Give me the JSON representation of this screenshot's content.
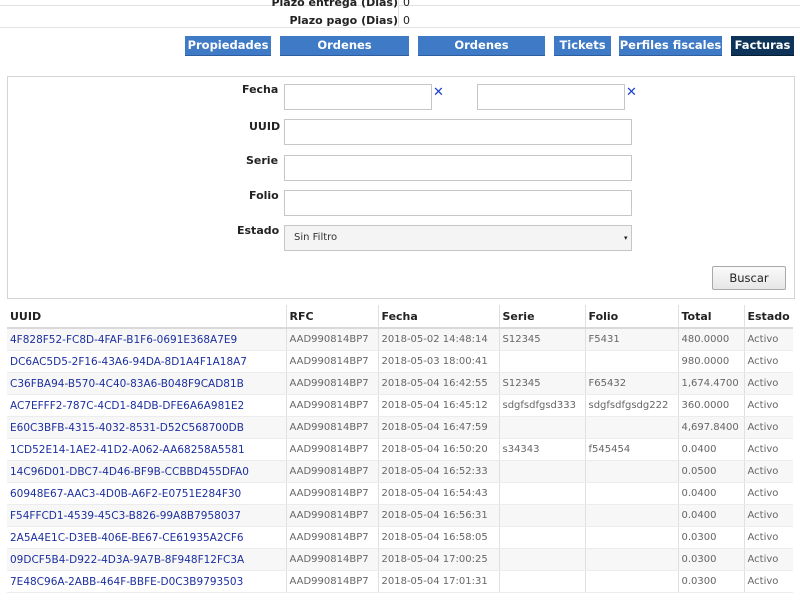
{
  "info": {
    "rows": [
      {
        "label": "Plazo entrega (Dias)",
        "value": "0"
      },
      {
        "label": "Plazo pago (Dias)",
        "value": "0"
      }
    ]
  },
  "tabs": [
    {
      "label": "Propiedades"
    },
    {
      "label": "Ordenes Pendientes"
    },
    {
      "label": "Ordenes Finalizadas"
    },
    {
      "label": "Tickets"
    },
    {
      "label": "Perfiles fiscales"
    },
    {
      "label": "Facturas",
      "active": true
    }
  ],
  "filters": {
    "fecha_label": "Fecha",
    "fecha_from": "",
    "fecha_to": "",
    "clear_glyph": "✕",
    "uuid_label": "UUID",
    "uuid_value": "",
    "serie_label": "Serie",
    "serie_value": "",
    "folio_label": "Folio",
    "folio_value": "",
    "estado_label": "Estado",
    "estado_selected": "Sin Filtro",
    "search_label": "Buscar"
  },
  "table": {
    "headers": [
      "UUID",
      "RFC",
      "Fecha",
      "Serie",
      "Folio",
      "Total",
      "Estado"
    ],
    "rows": [
      [
        "4F828F52-FC8D-4FAF-B1F6-0691E368A7E9",
        "AAD990814BP7",
        "2018-05-02 14:48:14",
        "S12345",
        "F5431",
        "480.0000",
        "Activo"
      ],
      [
        "DC6AC5D5-2F16-43A6-94DA-8D1A4F1A18A7",
        "AAD990814BP7",
        "2018-05-03 18:00:41",
        "",
        "",
        "980.0000",
        "Activo"
      ],
      [
        "C36FBA94-B570-4C40-83A6-B048F9CAD81B",
        "AAD990814BP7",
        "2018-05-04 16:42:55",
        "S12345",
        "F65432",
        "1,674.4700",
        "Activo"
      ],
      [
        "AC7EFFF2-787C-4CD1-84DB-DFE6A6A981E2",
        "AAD990814BP7",
        "2018-05-04 16:45:12",
        "sdgfsdfgsd333",
        "sdgfsdfgsdg222",
        "360.0000",
        "Activo"
      ],
      [
        "E60C3BFB-4315-4032-8531-D52C568700DB",
        "AAD990814BP7",
        "2018-05-04 16:47:59",
        "",
        "",
        "4,697.8400",
        "Activo"
      ],
      [
        "1CD52E14-1AE2-41D2-A062-AA68258A5581",
        "AAD990814BP7",
        "2018-05-04 16:50:20",
        "s34343",
        "f545454",
        "0.0400",
        "Activo"
      ],
      [
        "14C96D01-DBC7-4D46-BF9B-CCBBD455DFA0",
        "AAD990814BP7",
        "2018-05-04 16:52:33",
        "",
        "",
        "0.0500",
        "Activo"
      ],
      [
        "60948E67-AAC3-4D0B-A6F2-E0751E284F30",
        "AAD990814BP7",
        "2018-05-04 16:54:43",
        "",
        "",
        "0.0400",
        "Activo"
      ],
      [
        "F54FFCD1-4539-45C3-B826-99A8B7958037",
        "AAD990814BP7",
        "2018-05-04 16:56:31",
        "",
        "",
        "0.0400",
        "Activo"
      ],
      [
        "2A5A4E1C-D3EB-406E-BE67-CE61935A2CF6",
        "AAD990814BP7",
        "2018-05-04 16:58:05",
        "",
        "",
        "0.0300",
        "Activo"
      ],
      [
        "09DCF5B4-D922-4D3A-9A7B-8F948F12FC3A",
        "AAD990814BP7",
        "2018-05-04 17:00:25",
        "",
        "",
        "0.0300",
        "Activo"
      ],
      [
        "7E48C96A-2ABB-464F-BBFE-D0C3B9793503",
        "AAD990814BP7",
        "2018-05-04 17:01:31",
        "",
        "",
        "0.0300",
        "Activo"
      ]
    ]
  }
}
